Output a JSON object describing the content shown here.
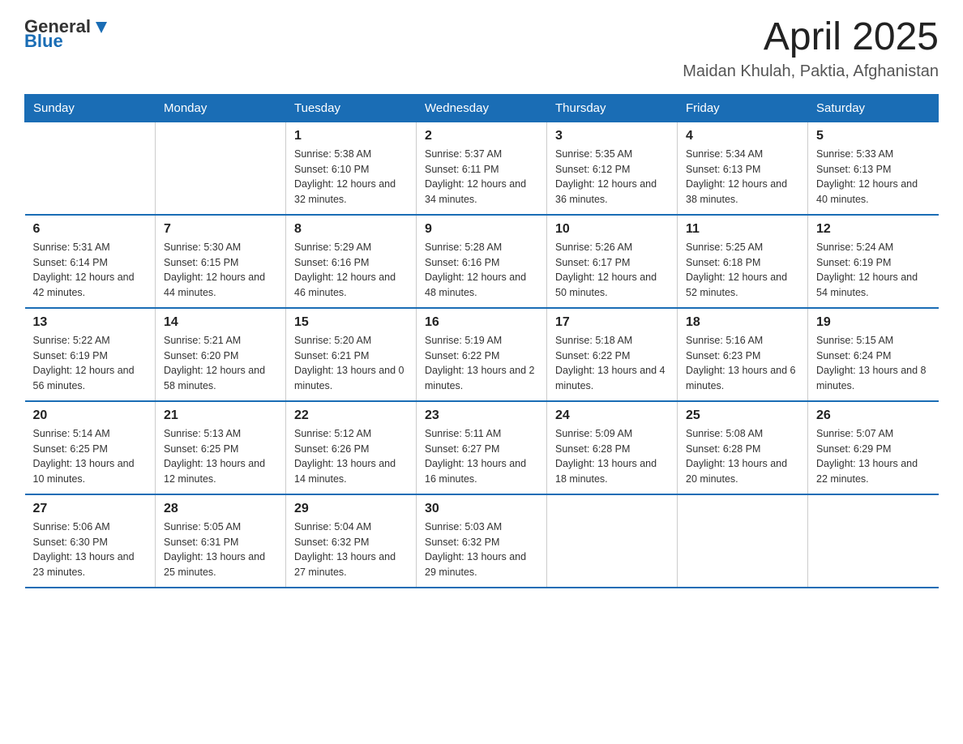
{
  "logo": {
    "general": "General",
    "blue": "Blue"
  },
  "header": {
    "month_year": "April 2025",
    "location": "Maidan Khulah, Paktia, Afghanistan"
  },
  "days_of_week": [
    "Sunday",
    "Monday",
    "Tuesday",
    "Wednesday",
    "Thursday",
    "Friday",
    "Saturday"
  ],
  "weeks": [
    [
      {
        "day": "",
        "sunrise": "",
        "sunset": "",
        "daylight": ""
      },
      {
        "day": "",
        "sunrise": "",
        "sunset": "",
        "daylight": ""
      },
      {
        "day": "1",
        "sunrise": "Sunrise: 5:38 AM",
        "sunset": "Sunset: 6:10 PM",
        "daylight": "Daylight: 12 hours and 32 minutes."
      },
      {
        "day": "2",
        "sunrise": "Sunrise: 5:37 AM",
        "sunset": "Sunset: 6:11 PM",
        "daylight": "Daylight: 12 hours and 34 minutes."
      },
      {
        "day": "3",
        "sunrise": "Sunrise: 5:35 AM",
        "sunset": "Sunset: 6:12 PM",
        "daylight": "Daylight: 12 hours and 36 minutes."
      },
      {
        "day": "4",
        "sunrise": "Sunrise: 5:34 AM",
        "sunset": "Sunset: 6:13 PM",
        "daylight": "Daylight: 12 hours and 38 minutes."
      },
      {
        "day": "5",
        "sunrise": "Sunrise: 5:33 AM",
        "sunset": "Sunset: 6:13 PM",
        "daylight": "Daylight: 12 hours and 40 minutes."
      }
    ],
    [
      {
        "day": "6",
        "sunrise": "Sunrise: 5:31 AM",
        "sunset": "Sunset: 6:14 PM",
        "daylight": "Daylight: 12 hours and 42 minutes."
      },
      {
        "day": "7",
        "sunrise": "Sunrise: 5:30 AM",
        "sunset": "Sunset: 6:15 PM",
        "daylight": "Daylight: 12 hours and 44 minutes."
      },
      {
        "day": "8",
        "sunrise": "Sunrise: 5:29 AM",
        "sunset": "Sunset: 6:16 PM",
        "daylight": "Daylight: 12 hours and 46 minutes."
      },
      {
        "day": "9",
        "sunrise": "Sunrise: 5:28 AM",
        "sunset": "Sunset: 6:16 PM",
        "daylight": "Daylight: 12 hours and 48 minutes."
      },
      {
        "day": "10",
        "sunrise": "Sunrise: 5:26 AM",
        "sunset": "Sunset: 6:17 PM",
        "daylight": "Daylight: 12 hours and 50 minutes."
      },
      {
        "day": "11",
        "sunrise": "Sunrise: 5:25 AM",
        "sunset": "Sunset: 6:18 PM",
        "daylight": "Daylight: 12 hours and 52 minutes."
      },
      {
        "day": "12",
        "sunrise": "Sunrise: 5:24 AM",
        "sunset": "Sunset: 6:19 PM",
        "daylight": "Daylight: 12 hours and 54 minutes."
      }
    ],
    [
      {
        "day": "13",
        "sunrise": "Sunrise: 5:22 AM",
        "sunset": "Sunset: 6:19 PM",
        "daylight": "Daylight: 12 hours and 56 minutes."
      },
      {
        "day": "14",
        "sunrise": "Sunrise: 5:21 AM",
        "sunset": "Sunset: 6:20 PM",
        "daylight": "Daylight: 12 hours and 58 minutes."
      },
      {
        "day": "15",
        "sunrise": "Sunrise: 5:20 AM",
        "sunset": "Sunset: 6:21 PM",
        "daylight": "Daylight: 13 hours and 0 minutes."
      },
      {
        "day": "16",
        "sunrise": "Sunrise: 5:19 AM",
        "sunset": "Sunset: 6:22 PM",
        "daylight": "Daylight: 13 hours and 2 minutes."
      },
      {
        "day": "17",
        "sunrise": "Sunrise: 5:18 AM",
        "sunset": "Sunset: 6:22 PM",
        "daylight": "Daylight: 13 hours and 4 minutes."
      },
      {
        "day": "18",
        "sunrise": "Sunrise: 5:16 AM",
        "sunset": "Sunset: 6:23 PM",
        "daylight": "Daylight: 13 hours and 6 minutes."
      },
      {
        "day": "19",
        "sunrise": "Sunrise: 5:15 AM",
        "sunset": "Sunset: 6:24 PM",
        "daylight": "Daylight: 13 hours and 8 minutes."
      }
    ],
    [
      {
        "day": "20",
        "sunrise": "Sunrise: 5:14 AM",
        "sunset": "Sunset: 6:25 PM",
        "daylight": "Daylight: 13 hours and 10 minutes."
      },
      {
        "day": "21",
        "sunrise": "Sunrise: 5:13 AM",
        "sunset": "Sunset: 6:25 PM",
        "daylight": "Daylight: 13 hours and 12 minutes."
      },
      {
        "day": "22",
        "sunrise": "Sunrise: 5:12 AM",
        "sunset": "Sunset: 6:26 PM",
        "daylight": "Daylight: 13 hours and 14 minutes."
      },
      {
        "day": "23",
        "sunrise": "Sunrise: 5:11 AM",
        "sunset": "Sunset: 6:27 PM",
        "daylight": "Daylight: 13 hours and 16 minutes."
      },
      {
        "day": "24",
        "sunrise": "Sunrise: 5:09 AM",
        "sunset": "Sunset: 6:28 PM",
        "daylight": "Daylight: 13 hours and 18 minutes."
      },
      {
        "day": "25",
        "sunrise": "Sunrise: 5:08 AM",
        "sunset": "Sunset: 6:28 PM",
        "daylight": "Daylight: 13 hours and 20 minutes."
      },
      {
        "day": "26",
        "sunrise": "Sunrise: 5:07 AM",
        "sunset": "Sunset: 6:29 PM",
        "daylight": "Daylight: 13 hours and 22 minutes."
      }
    ],
    [
      {
        "day": "27",
        "sunrise": "Sunrise: 5:06 AM",
        "sunset": "Sunset: 6:30 PM",
        "daylight": "Daylight: 13 hours and 23 minutes."
      },
      {
        "day": "28",
        "sunrise": "Sunrise: 5:05 AM",
        "sunset": "Sunset: 6:31 PM",
        "daylight": "Daylight: 13 hours and 25 minutes."
      },
      {
        "day": "29",
        "sunrise": "Sunrise: 5:04 AM",
        "sunset": "Sunset: 6:32 PM",
        "daylight": "Daylight: 13 hours and 27 minutes."
      },
      {
        "day": "30",
        "sunrise": "Sunrise: 5:03 AM",
        "sunset": "Sunset: 6:32 PM",
        "daylight": "Daylight: 13 hours and 29 minutes."
      },
      {
        "day": "",
        "sunrise": "",
        "sunset": "",
        "daylight": ""
      },
      {
        "day": "",
        "sunrise": "",
        "sunset": "",
        "daylight": ""
      },
      {
        "day": "",
        "sunrise": "",
        "sunset": "",
        "daylight": ""
      }
    ]
  ]
}
